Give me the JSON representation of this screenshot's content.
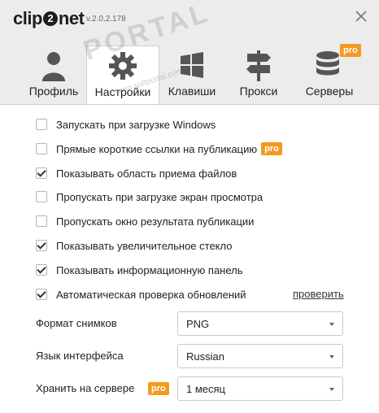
{
  "app": {
    "logo": "clip2net",
    "version": "v.2.0.2.178",
    "watermark": "PORTAL",
    "watermark_sub": "www.softportal.com"
  },
  "colors": {
    "pro_badge": "#f39a1e",
    "header_bg": "#ececec"
  },
  "tabs": [
    {
      "label": "Профиль",
      "icon": "user-icon",
      "active": false
    },
    {
      "label": "Настройки",
      "icon": "gear-icon",
      "active": true
    },
    {
      "label": "Клавиши",
      "icon": "windows-key-icon",
      "active": false
    },
    {
      "label": "Прокси",
      "icon": "signpost-icon",
      "active": false
    },
    {
      "label": "Серверы",
      "icon": "database-icon",
      "active": false,
      "pro": "pro"
    }
  ],
  "pro_label": "pro",
  "options": [
    {
      "label": "Запускать при загрузке Windows",
      "checked": false
    },
    {
      "label": "Прямые короткие ссылки на публикацию",
      "checked": false,
      "pro": true
    },
    {
      "label": "Показывать область приема файлов",
      "checked": true
    },
    {
      "label": "Пропускать при загрузке экран просмотра",
      "checked": false
    },
    {
      "label": "Пропускать окно результата публикации",
      "checked": false
    },
    {
      "label": "Показывать увеличительное стекло",
      "checked": true
    },
    {
      "label": "Показывать информационную панель",
      "checked": true
    },
    {
      "label": "Автоматическая проверка обновлений",
      "checked": true
    }
  ],
  "check_updates_link": "проверить",
  "form": {
    "format": {
      "label": "Формат снимков",
      "value": "PNG"
    },
    "language": {
      "label": "Язык интерфейса",
      "value": "Russian"
    },
    "storage": {
      "label": "Хранить на сервере",
      "value": "1 месяц",
      "pro": "pro"
    }
  }
}
